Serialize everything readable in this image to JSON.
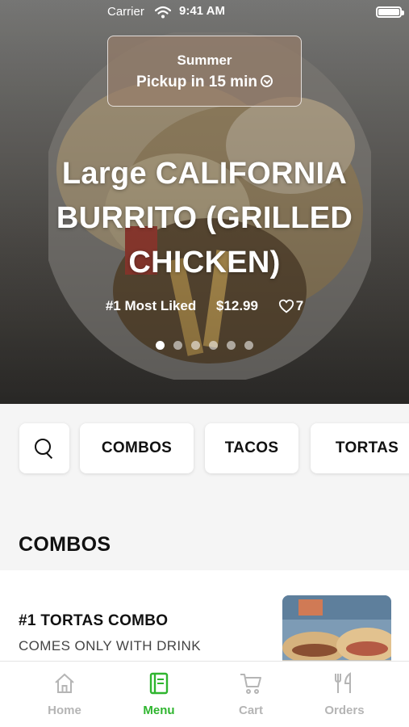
{
  "status_bar": {
    "carrier": "Carrier",
    "time": "9:41 AM"
  },
  "pickup": {
    "location": "Summer",
    "eta": "Pickup in 15 min"
  },
  "hero": {
    "title": "Large CALIFORNIA BURRITO (GRILLED CHICKEN)",
    "badge": "#1 Most Liked",
    "price": "$12.99",
    "likes": "7",
    "page_count": 6,
    "active_page": 0
  },
  "categories": [
    {
      "label": "COMBOS"
    },
    {
      "label": "TACOS"
    },
    {
      "label": "TORTAS"
    }
  ],
  "section": {
    "title": "COMBOS"
  },
  "menu_item": {
    "name": "#1 TORTAS COMBO",
    "description": "COMES ONLY WITH DRINK"
  },
  "tabs": [
    {
      "label": "Home",
      "icon": "home-icon",
      "active": false
    },
    {
      "label": "Menu",
      "icon": "menu-icon",
      "active": true
    },
    {
      "label": "Cart",
      "icon": "cart-icon",
      "active": false
    },
    {
      "label": "Orders",
      "icon": "orders-icon",
      "active": false
    }
  ],
  "colors": {
    "accent": "#2fb52f",
    "inactive_tab": "#b5b5b5"
  }
}
